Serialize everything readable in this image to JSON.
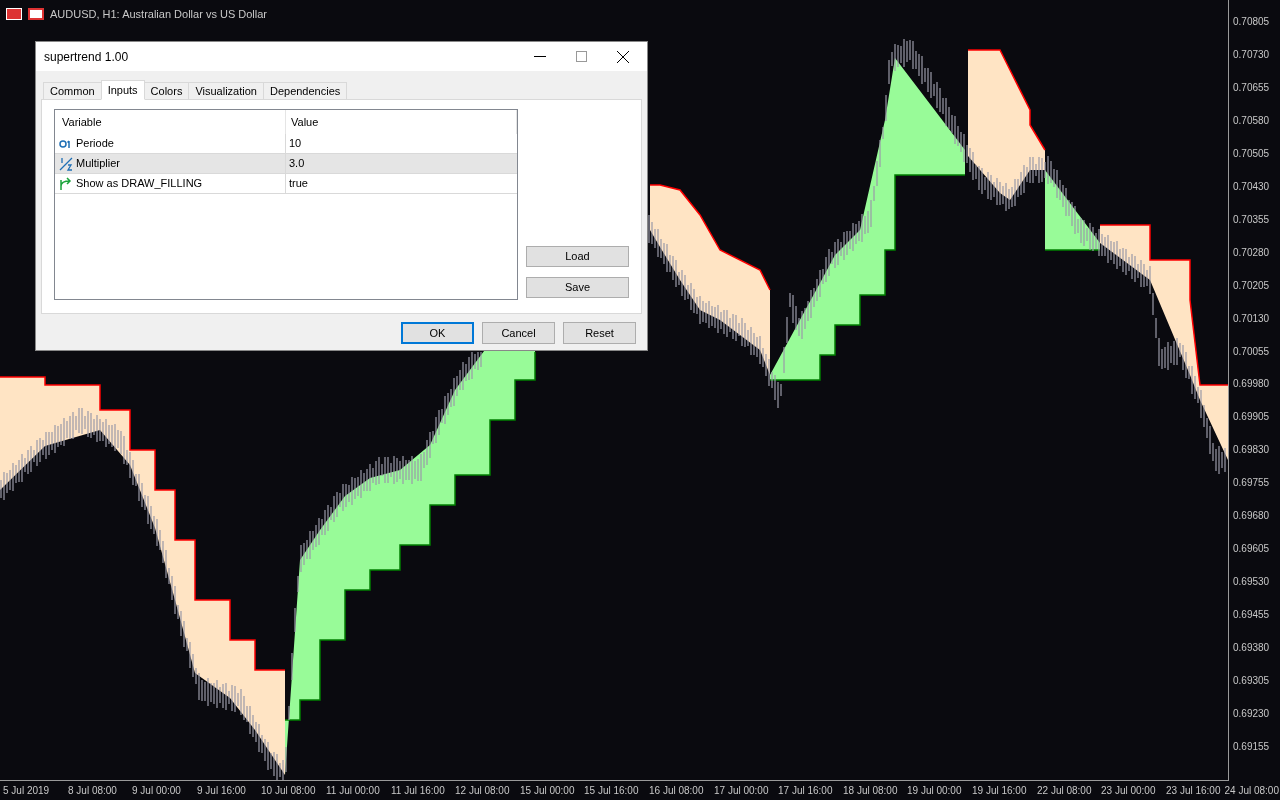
{
  "chart": {
    "title": "AUDUSD, H1:  Australian Dollar vs US Dollar",
    "y_axis": [
      "0.70805",
      "0.70730",
      "0.70655",
      "0.70580",
      "0.70505",
      "0.70430",
      "0.70355",
      "0.70280",
      "0.70205",
      "0.70130",
      "0.70055",
      "0.69980",
      "0.69905",
      "0.69830",
      "0.69755",
      "0.69680",
      "0.69605",
      "0.69530",
      "0.69455",
      "0.69380",
      "0.69305",
      "0.69230",
      "0.69155"
    ],
    "x_axis": [
      "5 Jul 2019",
      "8 Jul 08:00",
      "9 Jul 00:00",
      "9 Jul 16:00",
      "10 Jul 08:00",
      "11 Jul 00:00",
      "11 Jul 16:00",
      "12 Jul 08:00",
      "15 Jul 00:00",
      "15 Jul 16:00",
      "16 Jul 08:00",
      "17 Jul 00:00",
      "17 Jul 16:00",
      "18 Jul 08:00",
      "19 Jul 00:00",
      "19 Jul 16:00",
      "22 Jul 08:00",
      "23 Jul 00:00",
      "23 Jul 16:00",
      "24 Jul 08:00"
    ]
  },
  "dialog": {
    "title": "supertrend 1.00",
    "tabs": [
      {
        "label": "Common",
        "selected": false
      },
      {
        "label": "Inputs",
        "selected": true
      },
      {
        "label": "Colors",
        "selected": false
      },
      {
        "label": "Visualization",
        "selected": false
      },
      {
        "label": "Dependencies",
        "selected": false
      }
    ],
    "columns": [
      "Variable",
      "Value"
    ],
    "rows": [
      {
        "kind": "integer",
        "variable": "Periode",
        "value": "10",
        "selected": false
      },
      {
        "kind": "double",
        "variable": "Multiplier",
        "value": "3.0",
        "selected": true
      },
      {
        "kind": "bool",
        "variable": "Show as DRAW_FILLING",
        "value": "true",
        "selected": false
      }
    ],
    "side_buttons": [
      "Load",
      "Save"
    ],
    "buttons": [
      {
        "label": "OK",
        "default": true
      },
      {
        "label": "Cancel",
        "default": false
      },
      {
        "label": "Reset",
        "default": false
      }
    ]
  }
}
